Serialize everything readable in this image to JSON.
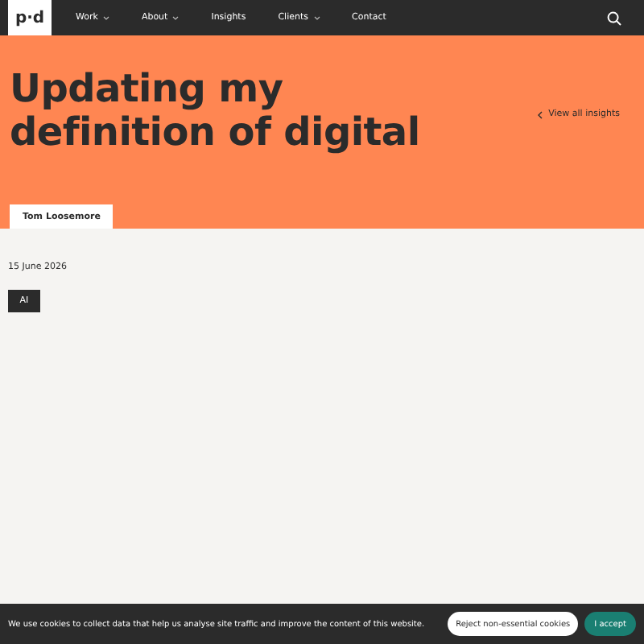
{
  "header": {
    "logo": "p·d",
    "nav": [
      {
        "label": "Work",
        "dropdown": true
      },
      {
        "label": "About",
        "dropdown": true
      },
      {
        "label": "Insights",
        "dropdown": false
      },
      {
        "label": "Clients",
        "dropdown": true
      },
      {
        "label": "Contact",
        "dropdown": false
      }
    ]
  },
  "hero": {
    "title": "Updating my definition of digital",
    "back_link": "View all insights",
    "author": "Tom Loosemore"
  },
  "article": {
    "date": "15 June 2026",
    "tags": [
      "AI"
    ]
  },
  "cookie_banner": {
    "message": "We use cookies to collect data that help us analyse site traffic and improve the content of this website.",
    "buttons": [
      {
        "label": "Reject non-essential cookies",
        "kind": "secondary"
      },
      {
        "label": "I accept",
        "kind": "primary"
      }
    ]
  }
}
